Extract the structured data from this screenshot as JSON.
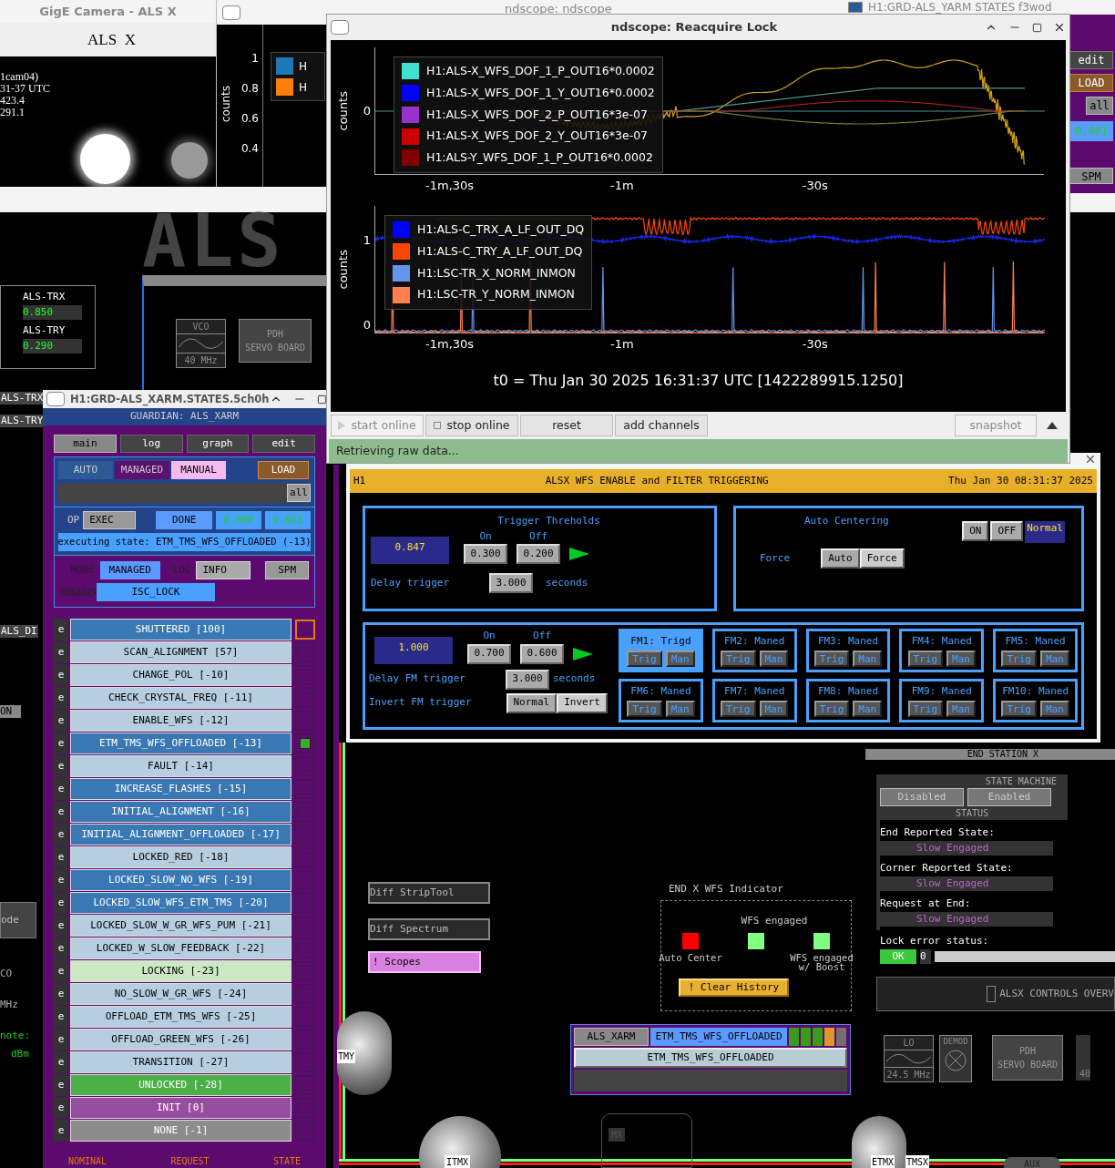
{
  "camera_window": {
    "title": "GigE Camera - ALS X",
    "heading": "ALS  X",
    "overlay_lines": [
      "1cam04)",
      "31-37 UTC",
      "423.4",
      "291.1"
    ]
  },
  "back_scope_window": {
    "title": "ndscope: ndscope",
    "ylabel": "counts",
    "yticks": [
      "1",
      "0.8",
      "0.6",
      "0.4"
    ],
    "legend": [
      {
        "label": "H",
        "color": "#1f77b4"
      },
      {
        "label": "H",
        "color": "#ff7f0e"
      }
    ]
  },
  "yarm_window": {
    "title": "H1:GRD-ALS_YARM STATES f3wod",
    "edit": "edit",
    "load": "LOAD",
    "all": "all",
    "reading": "0.001",
    "spm": "SPM"
  },
  "als_screen": {
    "logo": "ALS",
    "transmissions": [
      {
        "label": "ALS-TRX",
        "value": "0.850"
      },
      {
        "label": "ALS-TRY",
        "value": "0.290"
      }
    ],
    "vco": {
      "title": "VCO",
      "freq": "40 MHz"
    },
    "pdh": {
      "line1": "PDH",
      "line2": "SERVO BOARD"
    },
    "left_strip": [
      {
        "text": "ALS-TRX",
        "kind": "tab"
      },
      {
        "text": "ALS-TRY",
        "kind": "tab"
      },
      {
        "text": "ALS_DI",
        "kind": "tab"
      },
      {
        "text": "ON",
        "kind": "bar"
      },
      {
        "text": "ode",
        "kind": "box"
      },
      {
        "text": "CO",
        "kind": "label"
      },
      {
        "text": "MHz",
        "kind": "label"
      },
      {
        "text": "note:",
        "kind": "note"
      },
      {
        "text": "dBm",
        "kind": "note"
      }
    ]
  },
  "guardian": {
    "title": "H1:GRD-ALS_XARM.STATES.5ch0h",
    "header": "GUARDIAN: ALS_XARM",
    "nav": [
      {
        "label": "main",
        "selected": true
      },
      {
        "label": "log",
        "selected": false
      },
      {
        "label": "graph",
        "selected": false
      },
      {
        "label": "edit",
        "selected": false
      }
    ],
    "modes": [
      {
        "label": "AUTO",
        "color": "#2d5a96"
      },
      {
        "label": "MANAGED",
        "color": "#5c1070"
      },
      {
        "label": "MANUAL",
        "color": "#f8b8f0"
      }
    ],
    "load": "LOAD",
    "all": "all",
    "op_label": "OP",
    "op": "EXEC",
    "status": "DONE",
    "readings": [
      "0.000",
      "0.001"
    ],
    "executing": "executing state: ETM_TMS_WFS_OFFLOADED (-13)",
    "mode_label": "MODE",
    "mode": "MANAGED",
    "log_label": "LOG",
    "log": "INFO",
    "spm": "SPM",
    "manager_label": "MANAGER",
    "manager": "ISC_LOCK",
    "states": [
      {
        "edit": "e",
        "label": "SHUTTERED  [100]",
        "color": "#3a78b4",
        "nominal": true,
        "current": false
      },
      {
        "edit": "e",
        "label": "SCAN_ALIGNMENT  [57]",
        "color": "#b6cee0",
        "nominal": false,
        "current": false
      },
      {
        "edit": "e",
        "label": "CHANGE_POL  [-10]",
        "color": "#b6cee0",
        "nominal": false,
        "current": false
      },
      {
        "edit": "e",
        "label": "CHECK_CRYSTAL_FREQ  [-11]",
        "color": "#b6cee0",
        "nominal": false,
        "current": false
      },
      {
        "edit": "e",
        "label": "ENABLE_WFS  [-12]",
        "color": "#b6cee0",
        "nominal": false,
        "current": false
      },
      {
        "edit": "e",
        "label": "ETM_TMS_WFS_OFFLOADED  [-13]",
        "color": "#3a78b4",
        "nominal": false,
        "current": true
      },
      {
        "edit": "e",
        "label": "FAULT  [-14]",
        "color": "#b6cee0",
        "nominal": false,
        "current": false
      },
      {
        "edit": "e",
        "label": "INCREASE_FLASHES  [-15]",
        "color": "#3a78b4",
        "nominal": false,
        "current": false
      },
      {
        "edit": "e",
        "label": "INITIAL_ALIGNMENT  [-16]",
        "color": "#3a78b4",
        "nominal": false,
        "current": false
      },
      {
        "edit": "e",
        "label": "INITIAL_ALIGNMENT_OFFLOADED  [-17]",
        "color": "#3a78b4",
        "nominal": false,
        "current": false
      },
      {
        "edit": "e",
        "label": "LOCKED_RED  [-18]",
        "color": "#b6cee0",
        "nominal": false,
        "current": false
      },
      {
        "edit": "e",
        "label": "LOCKED_SLOW_NO_WFS  [-19]",
        "color": "#3a78b4",
        "nominal": false,
        "current": false
      },
      {
        "edit": "e",
        "label": "LOCKED_SLOW_WFS_ETM_TMS  [-20]",
        "color": "#3a78b4",
        "nominal": false,
        "current": false
      },
      {
        "edit": "e",
        "label": "LOCKED_SLOW_W_GR_WFS_PUM  [-21]",
        "color": "#b6cee0",
        "nominal": false,
        "current": false
      },
      {
        "edit": "e",
        "label": "LOCKED_W_SLOW_FEEDBACK  [-22]",
        "color": "#b6cee0",
        "nominal": false,
        "current": false
      },
      {
        "edit": "e",
        "label": "LOCKING  [-23]",
        "color": "#cce8c4",
        "nominal": false,
        "current": false
      },
      {
        "edit": "e",
        "label": "NO_SLOW_W_GR_WFS  [-24]",
        "color": "#b6cee0",
        "nominal": false,
        "current": false
      },
      {
        "edit": "e",
        "label": "OFFLOAD_ETM_TMS_WFS  [-25]",
        "color": "#b6cee0",
        "nominal": false,
        "current": false
      },
      {
        "edit": "e",
        "label": "OFFLOAD_GREEN_WFS  [-26]",
        "color": "#b6cee0",
        "nominal": false,
        "current": false
      },
      {
        "edit": "e",
        "label": "TRANSITION  [-27]",
        "color": "#b6cee0",
        "nominal": false,
        "current": false
      },
      {
        "edit": "e",
        "label": "UNLOCKED  [-28]",
        "color": "#4caf48",
        "nominal": false,
        "current": false
      },
      {
        "edit": "e",
        "label": "INIT  [0]",
        "color": "#984ea0",
        "nominal": false,
        "current": false
      },
      {
        "edit": "e",
        "label": "NONE  [-1]",
        "color": "#8c8c8c",
        "nominal": false,
        "current": false
      }
    ],
    "footer": [
      "NOMINAL",
      "REQUEST",
      "STATE"
    ]
  },
  "ndscope": {
    "title": "ndscope: Reacquire Lock",
    "plots": [
      {
        "ylabel": "counts",
        "yticks": [
          "0"
        ],
        "xticks": [
          "-1m,30s",
          "-1m",
          "-30s"
        ],
        "legend": [
          {
            "label": "H1:ALS-X_WFS_DOF_1_P_OUT16*0.0002",
            "color": "#40e0d0"
          },
          {
            "label": "H1:ALS-X_WFS_DOF_1_Y_OUT16*0.0002",
            "color": "#0000ff"
          },
          {
            "label": "H1:ALS-X_WFS_DOF_2_P_OUT16*3e-07",
            "color": "#9932cc"
          },
          {
            "label": "H1:ALS-X_WFS_DOF_2_Y_OUT16*3e-07",
            "color": "#cc0000"
          },
          {
            "label": "H1:ALS-Y_WFS_DOF_1_P_OUT16*0.0002",
            "color": "#800000"
          }
        ]
      },
      {
        "ylabel": "counts",
        "yticks": [
          "1",
          "0"
        ],
        "xticks": [
          "-1m,30s",
          "-1m",
          "-30s"
        ],
        "legend": [
          {
            "label": "H1:ALS-C_TRX_A_LF_OUT_DQ",
            "color": "#0000ff"
          },
          {
            "label": "H1:ALS-C_TRY_A_LF_OUT_DQ",
            "color": "#ff4500"
          },
          {
            "label": "H1:LSC-TR_X_NORM_INMON",
            "color": "#6495ed"
          },
          {
            "label": "H1:LSC-TR_Y_NORM_INMON",
            "color": "#ff7f50"
          }
        ]
      }
    ],
    "t0": "t0 = Thu Jan 30 2025 16:31:37 UTC [1422289915.1250]",
    "buttons": [
      {
        "label": "start online",
        "kind": "play",
        "disabled": true
      },
      {
        "label": "stop online",
        "kind": "stop",
        "disabled": false
      },
      {
        "label": "reset",
        "kind": "plain",
        "disabled": false
      },
      {
        "label": "add channels",
        "kind": "plain",
        "disabled": false
      },
      {
        "label": "snapshot",
        "kind": "right",
        "disabled": true
      }
    ],
    "status": "Retrieving raw data..."
  },
  "wfs": {
    "site": "H1",
    "title": "ALSX WFS ENABLE and FILTER TRIGGERING",
    "date": "Thu Jan 30 08:31:37 2025",
    "trigger": {
      "title": "Trigger Threholds",
      "value": "0.847",
      "on_label": "On",
      "off_label": "Off",
      "on": "0.300",
      "off": "0.200",
      "delay_label": "Delay trigger",
      "delay": "3.000",
      "unit": "seconds"
    },
    "centering": {
      "title": "Auto Centering",
      "on": "ON",
      "off": "OFF",
      "state": "Normal",
      "force_label": "Force",
      "auto": "Auto",
      "force": "Force"
    },
    "fm": {
      "value": "1.000",
      "on_label": "On",
      "off_label": "Off",
      "on": "0.700",
      "off": "0.600",
      "delay_label": "Delay FM trigger",
      "delay": "3.000",
      "unit": "seconds",
      "invert_label": "Invert FM trigger",
      "normal": "Normal",
      "invert": "Invert",
      "modules": [
        {
          "label": "FM1: Trigd",
          "selected": true,
          "trig": "Trig",
          "man": "Man"
        },
        {
          "label": "FM2: Maned",
          "selected": false,
          "trig": "Trig",
          "man": "Man"
        },
        {
          "label": "FM3: Maned",
          "selected": false,
          "trig": "Trig",
          "man": "Man"
        },
        {
          "label": "FM4: Maned",
          "selected": false,
          "trig": "Trig",
          "man": "Man"
        },
        {
          "label": "FM5: Maned",
          "selected": false,
          "trig": "Trig",
          "man": "Man"
        },
        {
          "label": "FM6: Maned",
          "selected": false,
          "trig": "Trig",
          "man": "Man"
        },
        {
          "label": "FM7: Maned",
          "selected": false,
          "trig": "Trig",
          "man": "Man"
        },
        {
          "label": "FM8: Maned",
          "selected": false,
          "trig": "Trig",
          "man": "Man"
        },
        {
          "label": "FM9: Maned",
          "selected": false,
          "trig": "Trig",
          "man": "Man"
        },
        {
          "label": "FM10: Maned",
          "selected": false,
          "trig": "Trig",
          "man": "Man"
        }
      ]
    }
  },
  "overview": {
    "links": [
      {
        "label": "Diff StripTool",
        "kind": "related"
      },
      {
        "label": "Diff Spectrum",
        "kind": "related"
      },
      {
        "label": "! Scopes",
        "kind": "shell"
      }
    ],
    "indicator": {
      "title": "END X WFS Indicator",
      "heading": "WFS engaged",
      "lamps": [
        {
          "color": "#ff0000",
          "label": "Auto Center"
        },
        {
          "color": "#80ff80"
        },
        {
          "color": "#80ff80",
          "label": "WFS engaged w/ Boost"
        }
      ],
      "clear": "! Clear History"
    },
    "mini_guardian": {
      "node": "ALS_XARM",
      "state": "ETM_TMS_WFS_OFFLOADED",
      "request": "ETM_TMS_WFS_OFFLOADED",
      "flags": [
        {
          "color": "#3c9a1c"
        },
        {
          "color": "#3c9a1c"
        },
        {
          "color": "#3c9a1c"
        },
        {
          "color": "#e0982a"
        },
        {
          "color": "#707070"
        }
      ]
    },
    "end_station": {
      "title": "END STATION X",
      "section": "STATE MACHINE",
      "disabled": "Disabled",
      "enabled": "Enabled",
      "status_title": "STATUS",
      "rows": [
        {
          "label": "End Reported State:",
          "value": "Slow Engaged"
        },
        {
          "label": "Corner Reported State:",
          "value": "Slow Engaged"
        },
        {
          "label": "Request at End:",
          "value": "Slow Engaged"
        }
      ],
      "lock_label": "Lock error status:",
      "lock_state": "OK",
      "lock_value": "0",
      "controls": "ALSX CONTROLS OVERV",
      "lo": {
        "title": "LO",
        "freq": "24.5 MHz"
      },
      "demod": "DEMOD",
      "pdh": {
        "line1": "PDH",
        "line2": "SERVO BOARD"
      },
      "fragment": "40"
    },
    "optics": [
      "TMY",
      "ITMX",
      "MX",
      "ETMX",
      "TMSX",
      "AUX"
    ]
  }
}
